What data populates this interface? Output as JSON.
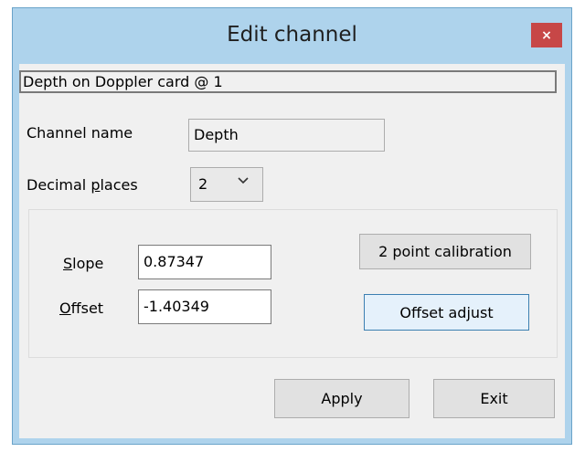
{
  "window": {
    "title": "Edit channel",
    "close_glyph": "×"
  },
  "info": {
    "text": "Depth on Doppler card @ 1"
  },
  "channel_name": {
    "label": "Channel name",
    "value": "Depth"
  },
  "decimal_places": {
    "label_prefix": "Decimal ",
    "label_accel": "p",
    "label_suffix": "laces",
    "value": "2",
    "chevron": "⌄"
  },
  "calibration": {
    "slope_label_accel": "S",
    "slope_label_rest": "lope",
    "slope_value": "0.87347",
    "offset_label_accel": "O",
    "offset_label_rest": "ffset",
    "offset_value": "-1.40349",
    "two_point_button": "2 point calibration",
    "offset_adjust_button": "Offset adjust"
  },
  "footer": {
    "apply_button": "Apply",
    "exit_button": "Exit"
  },
  "colors": {
    "titlebar": "#aed3ec",
    "close_button": "#c74747",
    "client_background": "#f0f0f0"
  }
}
